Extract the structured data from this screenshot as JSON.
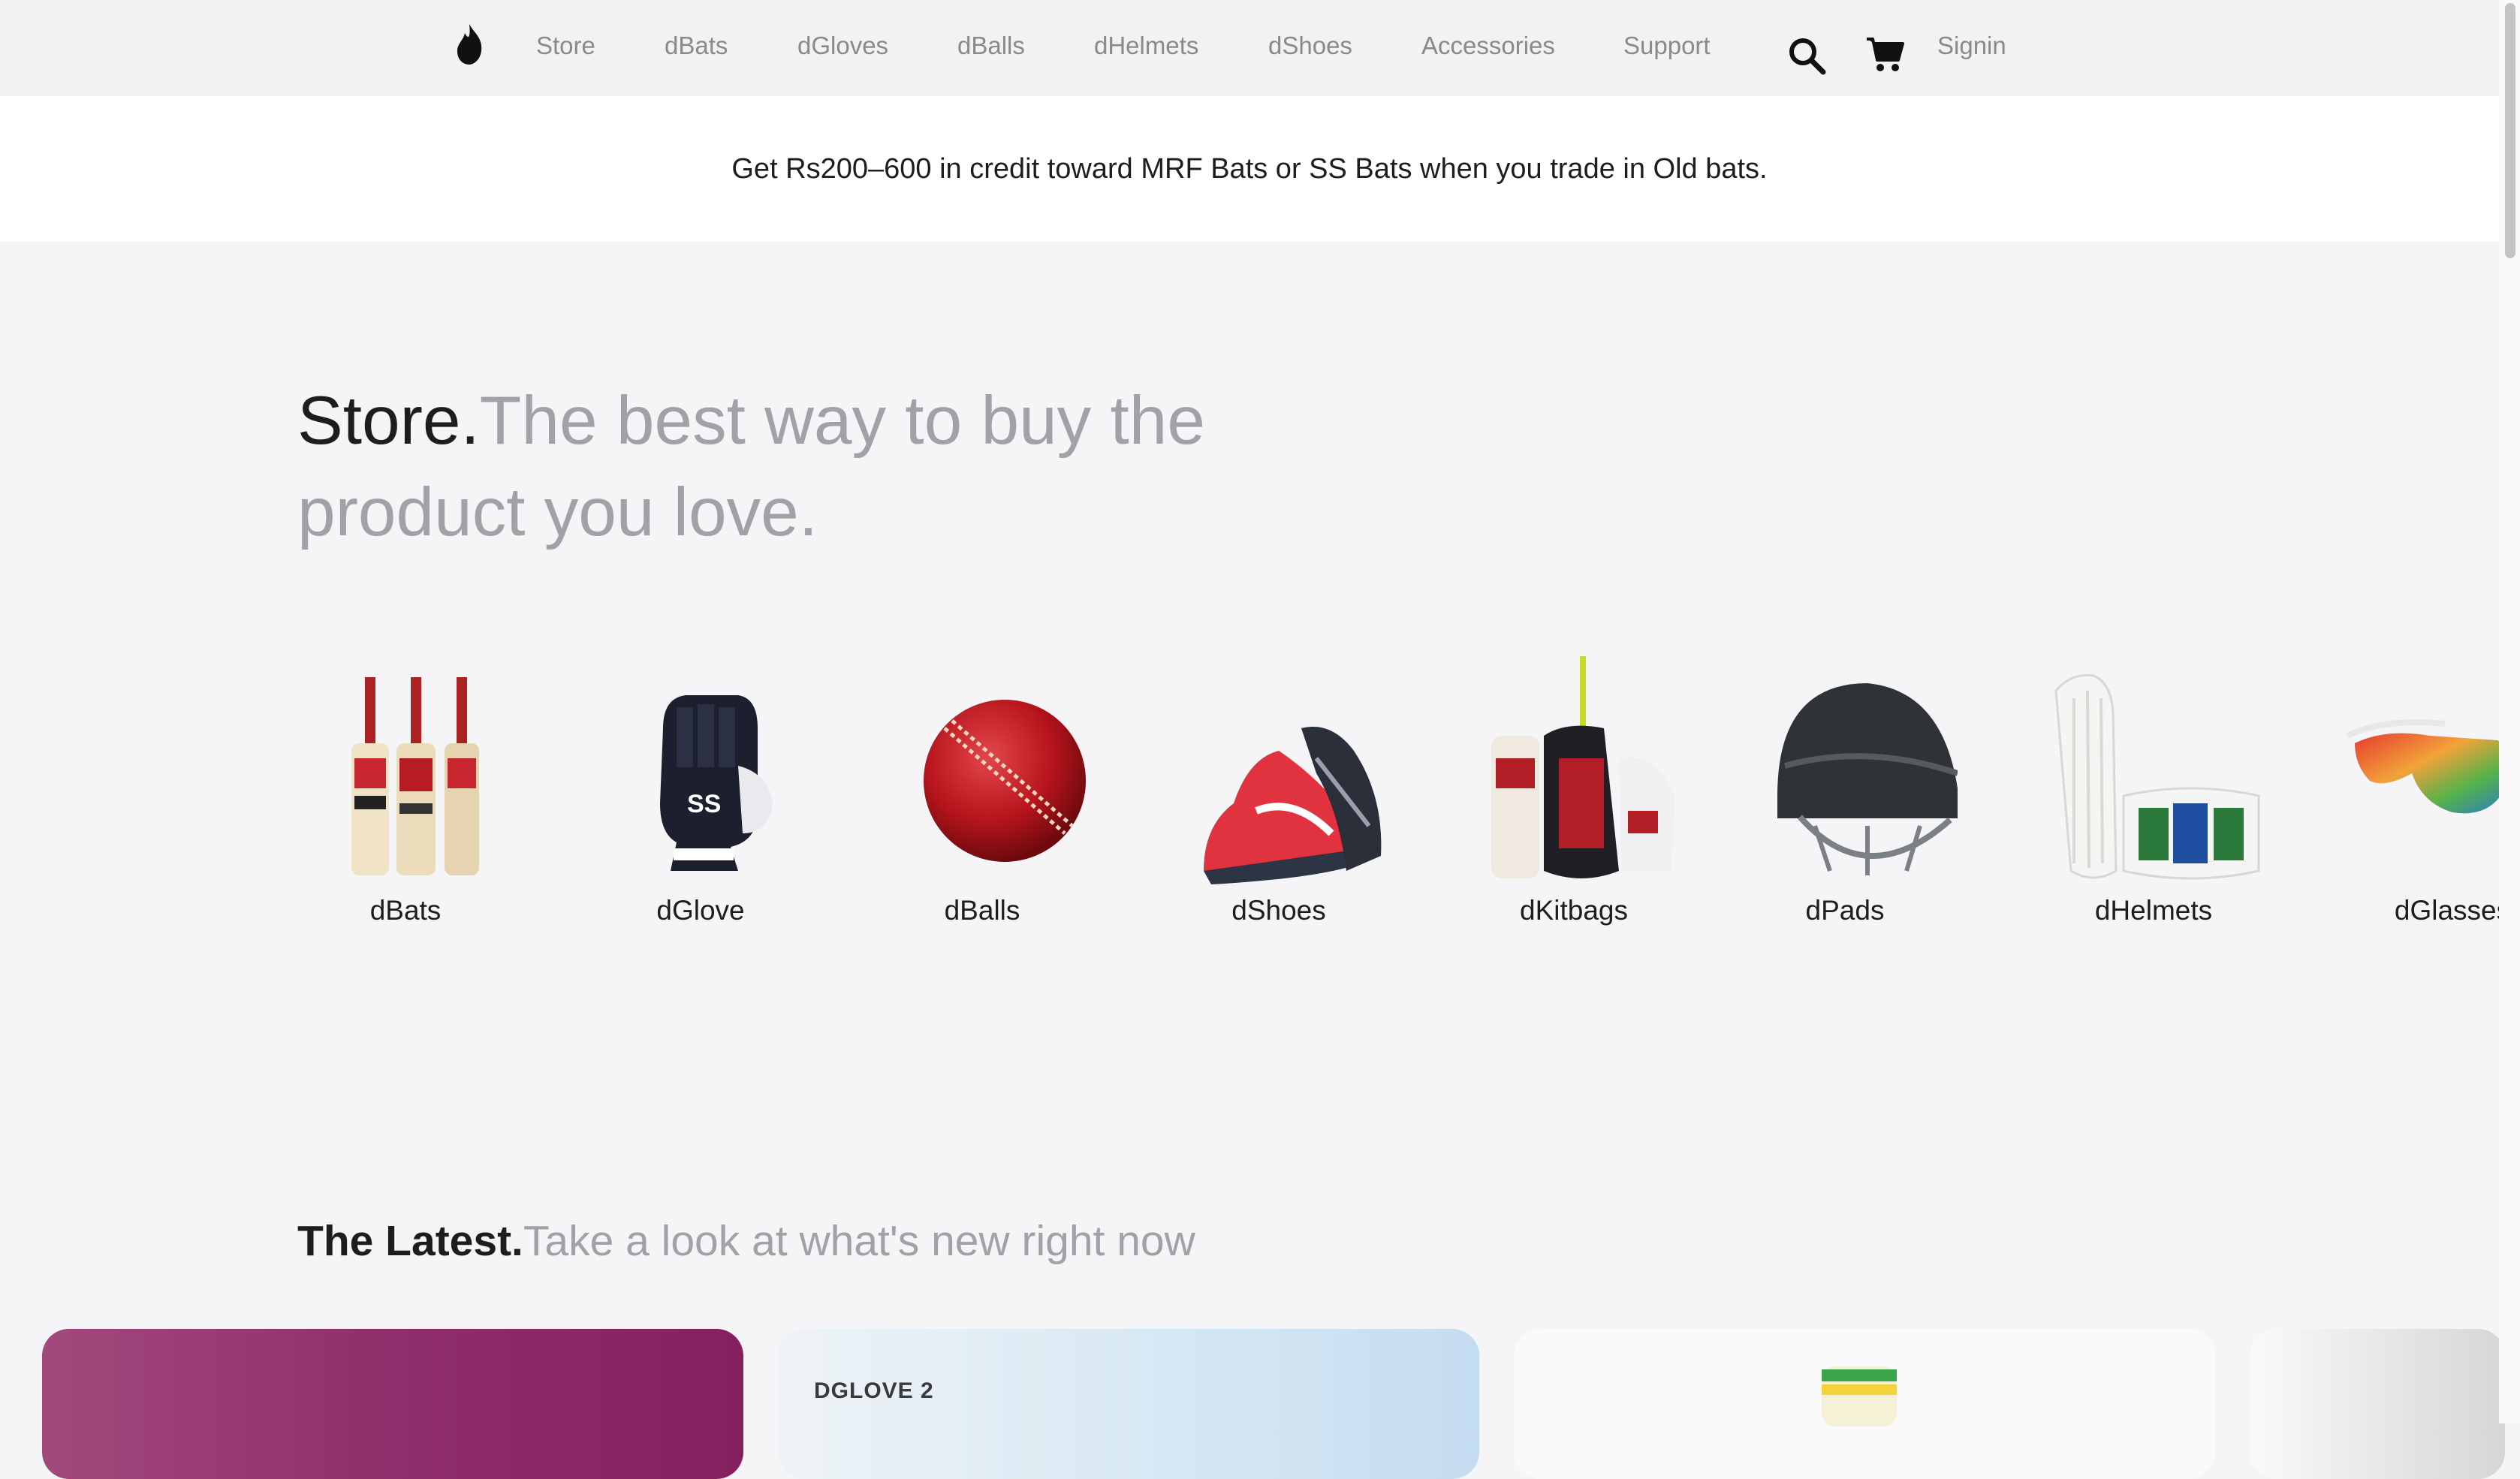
{
  "nav": {
    "items": [
      "Store",
      "dBats",
      "dGloves",
      "dBalls",
      "dHelmets",
      "dShoes",
      "Accessories",
      "Support"
    ],
    "signin": "Signin",
    "logo_icon": "flame-logo",
    "search_icon": "search-icon",
    "cart_icon": "cart-icon"
  },
  "promo": {
    "text": "Get Rs200–600 in credit toward MRF Bats or SS Bats when you trade in Old bats."
  },
  "hero": {
    "strong": "Store.",
    "rest": "The best way to buy the product you love."
  },
  "categories": [
    {
      "label": "dBats",
      "icon": "cricket-bats-icon"
    },
    {
      "label": "dGlove",
      "icon": "batting-glove-icon"
    },
    {
      "label": "dBalls",
      "icon": "cricket-ball-icon"
    },
    {
      "label": "dShoes",
      "icon": "shoes-icon"
    },
    {
      "label": "dKitbags",
      "icon": "kitbag-icon"
    },
    {
      "label": "dPads",
      "icon": "helmet-icon"
    },
    {
      "label": "dHelmets",
      "icon": "leg-pads-icon"
    },
    {
      "label": "dGlasses",
      "icon": "sunglasses-icon"
    }
  ],
  "latest": {
    "strong": "The Latest.",
    "rest": "Take a look at what's new right now"
  },
  "cards": [
    {
      "title": ""
    },
    {
      "title": "DGLOVE 2"
    },
    {
      "title": ""
    },
    {
      "title": ""
    }
  ],
  "colors": {
    "nav_bg": "#f2f2f2",
    "page_bg": "#f5f5f7",
    "text_primary": "#1d1d1f",
    "text_secondary": "#a1a1a6"
  }
}
